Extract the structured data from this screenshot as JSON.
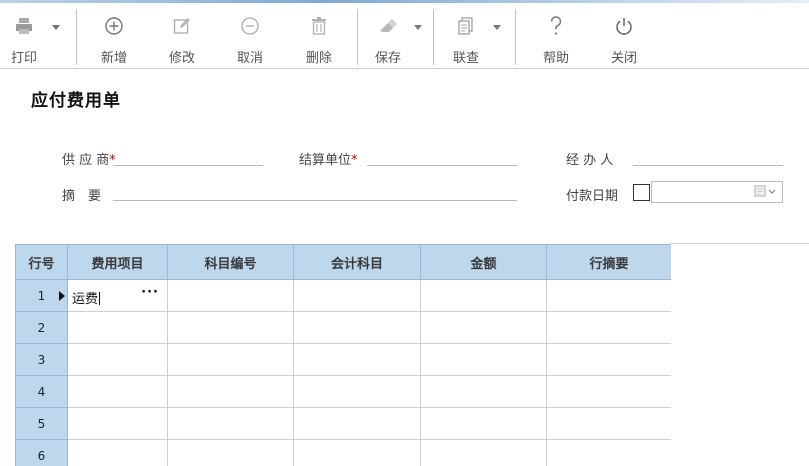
{
  "toolbar": {
    "print": "打印",
    "new": "新增",
    "edit": "修改",
    "cancel": "取消",
    "delete": "删除",
    "save": "保存",
    "link": "联查",
    "help": "帮助",
    "close": "关闭"
  },
  "form": {
    "title": "应付费用单",
    "supplier_label": "供 应 商",
    "settle_unit_label": "结算单位",
    "handler_label": "经 办 人",
    "summary_label": "摘　要",
    "pay_date_label": "付款日期",
    "required_mark": "*"
  },
  "grid": {
    "headers": [
      "行号",
      "费用项目",
      "科目编号",
      "会计科目",
      "金额",
      "行摘要"
    ],
    "rows": [
      {
        "num": "1",
        "item": "运费",
        "code": "",
        "account": "",
        "amount": "",
        "memo": ""
      },
      {
        "num": "2",
        "item": "",
        "code": "",
        "account": "",
        "amount": "",
        "memo": ""
      },
      {
        "num": "3",
        "item": "",
        "code": "",
        "account": "",
        "amount": "",
        "memo": ""
      },
      {
        "num": "4",
        "item": "",
        "code": "",
        "account": "",
        "amount": "",
        "memo": ""
      },
      {
        "num": "5",
        "item": "",
        "code": "",
        "account": "",
        "amount": "",
        "memo": ""
      },
      {
        "num": "6",
        "item": "",
        "code": "",
        "account": "",
        "amount": "",
        "memo": ""
      }
    ],
    "lookup_button": "···"
  }
}
